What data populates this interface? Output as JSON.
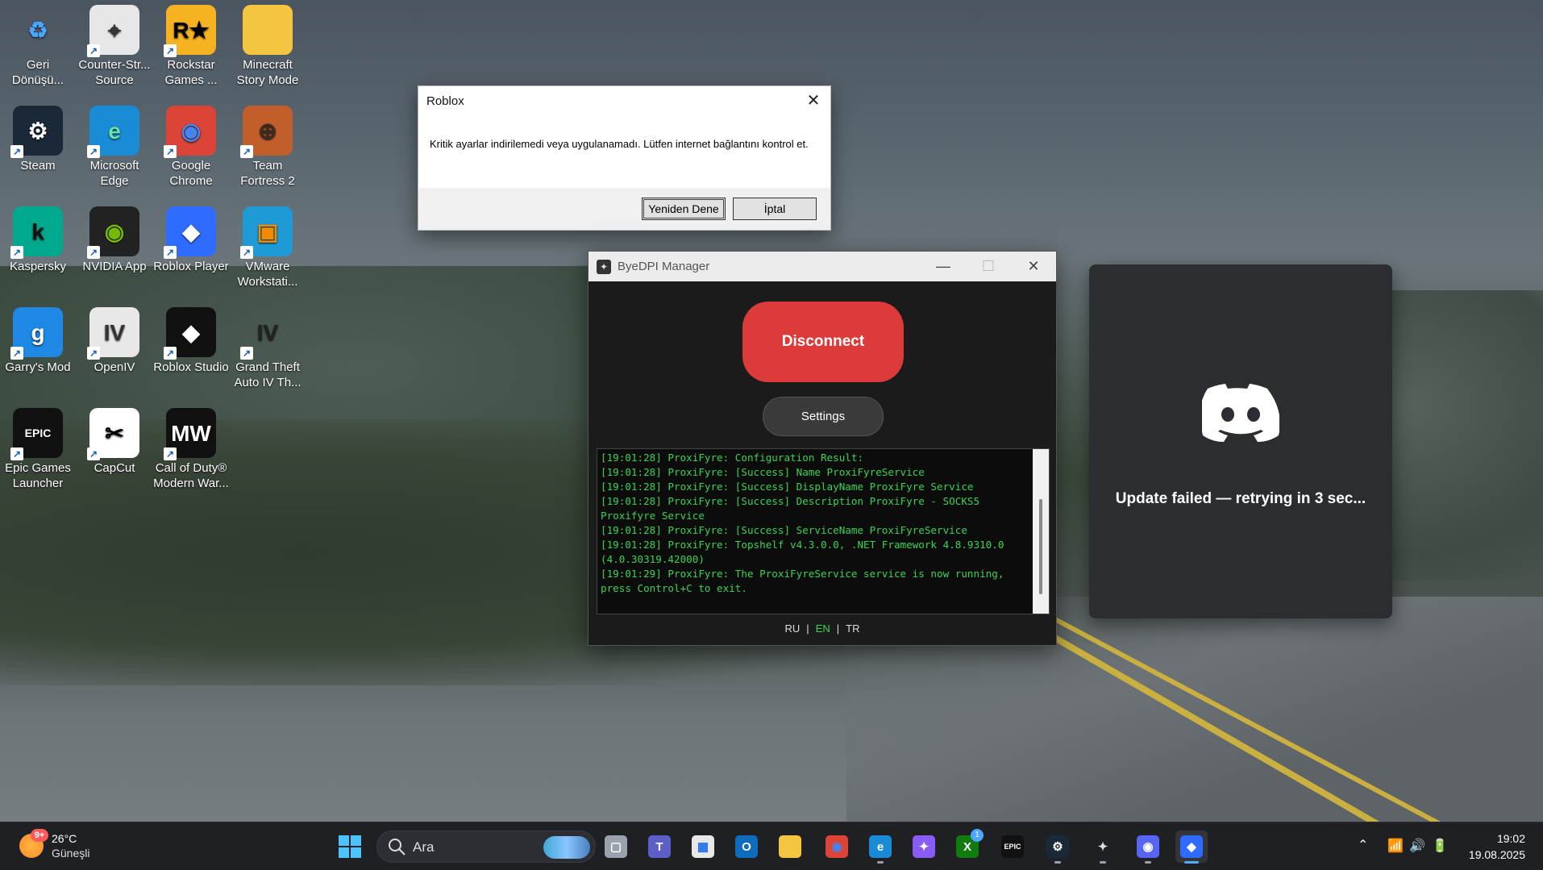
{
  "desktop": {
    "icons": [
      {
        "label": "Geri Dönüşü...",
        "icon": "recycle-bin-icon"
      },
      {
        "label": "Counter-Str... Source",
        "icon": "counter-strike-icon"
      },
      {
        "label": "Rockstar Games ...",
        "icon": "rockstar-icon"
      },
      {
        "label": "Minecraft Story Mode",
        "icon": "folder-icon"
      },
      {
        "label": "Steam",
        "icon": "steam-icon"
      },
      {
        "label": "Microsoft Edge",
        "icon": "edge-icon"
      },
      {
        "label": "Google Chrome",
        "icon": "chrome-icon"
      },
      {
        "label": "Team Fortress 2",
        "icon": "tf2-icon"
      },
      {
        "label": "Kaspersky",
        "icon": "kaspersky-icon"
      },
      {
        "label": "NVIDIA App",
        "icon": "nvidia-icon"
      },
      {
        "label": "Roblox Player",
        "icon": "roblox-player-icon"
      },
      {
        "label": "VMware Workstati...",
        "icon": "vmware-icon"
      },
      {
        "label": "Garry's Mod",
        "icon": "garrys-mod-icon"
      },
      {
        "label": "OpenIV",
        "icon": "openiv-icon"
      },
      {
        "label": "Roblox Studio",
        "icon": "roblox-studio-icon"
      },
      {
        "label": "Grand Theft Auto IV Th...",
        "icon": "gta-iv-icon"
      },
      {
        "label": "Epic Games Launcher",
        "icon": "epic-games-icon"
      },
      {
        "label": "CapCut",
        "icon": "capcut-icon"
      },
      {
        "label": "Call of Duty® Modern War...",
        "icon": "call-of-duty-icon"
      }
    ]
  },
  "roblox_dialog": {
    "title": "Roblox",
    "message": "Kritik ayarlar indirilemedi veya uygulanamadı. Lütfen internet bağlantını kontrol et.",
    "retry_label": "Yeniden Dene",
    "cancel_label": "İptal"
  },
  "byedpi": {
    "title": "ByeDPI Manager",
    "disconnect_label": "Disconnect",
    "settings_label": "Settings",
    "log": [
      "[19:01:28] ProxiFyre: Configuration Result:",
      "[19:01:28] ProxiFyre: [Success] Name ProxiFyreService",
      "[19:01:28] ProxiFyre: [Success] DisplayName ProxiFyre Service",
      "[19:01:28] ProxiFyre: [Success] Description ProxiFyre - SOCKS5 Proxifyre Service",
      "[19:01:28] ProxiFyre: [Success] ServiceName ProxiFyreService",
      "[19:01:28] ProxiFyre: Topshelf v4.3.0.0, .NET Framework 4.8.9310.0 (4.0.30319.42000)",
      "[19:01:29] ProxiFyre: The ProxiFyreService service is now running, press Control+C to exit."
    ],
    "languages": [
      "RU",
      "EN",
      "TR"
    ],
    "active_language": "EN",
    "separator": "|",
    "colors": {
      "disconnect": "#dd3a3a",
      "log_text": "#39d353"
    }
  },
  "discord": {
    "message": "Update failed — retrying in 3 sec...",
    "icon": "discord-logo-icon",
    "background": "#2b2d31"
  },
  "taskbar": {
    "weather": {
      "temp": "26°C",
      "condition": "Güneşli",
      "badge": "9+"
    },
    "search_placeholder": "Ara",
    "apps": [
      {
        "name": "start-button",
        "icon": "windows-logo-icon"
      },
      {
        "name": "task-view",
        "icon": "task-view-icon"
      },
      {
        "name": "teams",
        "icon": "teams-icon"
      },
      {
        "name": "microsoft-store",
        "icon": "store-icon"
      },
      {
        "name": "outlook",
        "icon": "outlook-icon"
      },
      {
        "name": "file-explorer",
        "icon": "folder-icon"
      },
      {
        "name": "chrome",
        "icon": "chrome-icon"
      },
      {
        "name": "edge-beta",
        "icon": "edge-icon"
      },
      {
        "name": "copilot",
        "icon": "copilot-icon"
      },
      {
        "name": "xbox",
        "icon": "xbox-icon",
        "badge": "1"
      },
      {
        "name": "epic-games",
        "icon": "epic-games-icon"
      },
      {
        "name": "steam",
        "icon": "steam-icon"
      },
      {
        "name": "byedpi",
        "icon": "byedpi-icon"
      },
      {
        "name": "discord",
        "icon": "discord-icon"
      },
      {
        "name": "roblox",
        "icon": "roblox-icon"
      }
    ],
    "time": "19:02",
    "date": "19.08.2025"
  }
}
